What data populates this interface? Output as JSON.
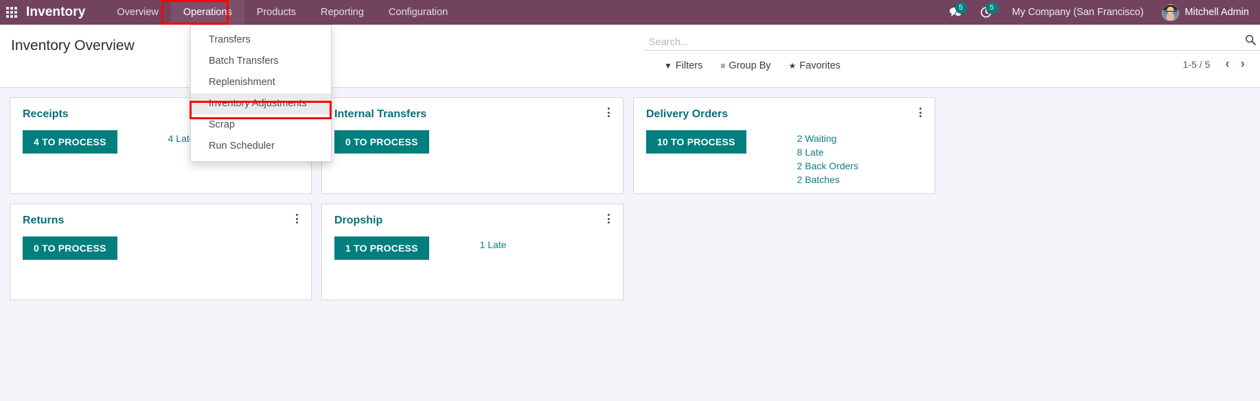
{
  "navbar": {
    "apps_icon": "apps-grid-icon",
    "brand": "Inventory",
    "menu": [
      {
        "label": "Overview",
        "active": false
      },
      {
        "label": "Operations",
        "active": true
      },
      {
        "label": "Products",
        "active": false
      },
      {
        "label": "Reporting",
        "active": false
      },
      {
        "label": "Configuration",
        "active": false
      }
    ],
    "messages": {
      "icon": "chat-bubble-icon",
      "count": "5"
    },
    "activities": {
      "icon": "clock-activity-icon",
      "count": "5"
    },
    "company": "My Company (San Francisco)",
    "user": "Mitchell Admin",
    "avatar_icon": "user-avatar"
  },
  "dropdown": {
    "open_for": "Operations",
    "items": [
      {
        "label": "Transfers",
        "highlighted": false
      },
      {
        "label": "Batch Transfers",
        "highlighted": false
      },
      {
        "label": "Replenishment",
        "highlighted": false
      },
      {
        "label": "Inventory Adjustments",
        "highlighted": true
      },
      {
        "label": "Scrap",
        "highlighted": false
      },
      {
        "label": "Run Scheduler",
        "highlighted": false
      }
    ]
  },
  "control_panel": {
    "title": "Inventory Overview",
    "search": {
      "value": "",
      "placeholder": "Search...",
      "icon": "search-icon"
    },
    "tools": [
      {
        "label": "Filters",
        "icon": "filter-icon",
        "glyph": "▼"
      },
      {
        "label": "Group By",
        "icon": "group-by-icon",
        "glyph": "≡"
      },
      {
        "label": "Favorites",
        "icon": "star-icon",
        "glyph": "★"
      }
    ],
    "pager": {
      "count": "1-5 / 5",
      "prev": "‹",
      "next": "›"
    }
  },
  "cards": [
    {
      "title": "Receipts",
      "button": "4 TO PROCESS",
      "stats": [
        "4 Late"
      ]
    },
    {
      "title": "Internal Transfers",
      "button": "0 TO PROCESS",
      "stats": []
    },
    {
      "title": "Delivery Orders",
      "button": "10 TO PROCESS",
      "stats": [
        "2 Waiting",
        "8 Late",
        "2 Back Orders",
        "2 Batches"
      ]
    },
    {
      "title": "Returns",
      "button": "0 TO PROCESS",
      "stats": []
    },
    {
      "title": "Dropship",
      "button": "1 TO PROCESS",
      "stats": [
        "1 Late"
      ]
    }
  ],
  "colors": {
    "navbar": "#71435f",
    "navbar_active": "#7d5069",
    "accent_teal": "#017e7e",
    "card_title": "#0b6e76",
    "stat_text": "#0e7c84",
    "page_bg": "#f4f5fa",
    "annotation": "#ff0000"
  }
}
